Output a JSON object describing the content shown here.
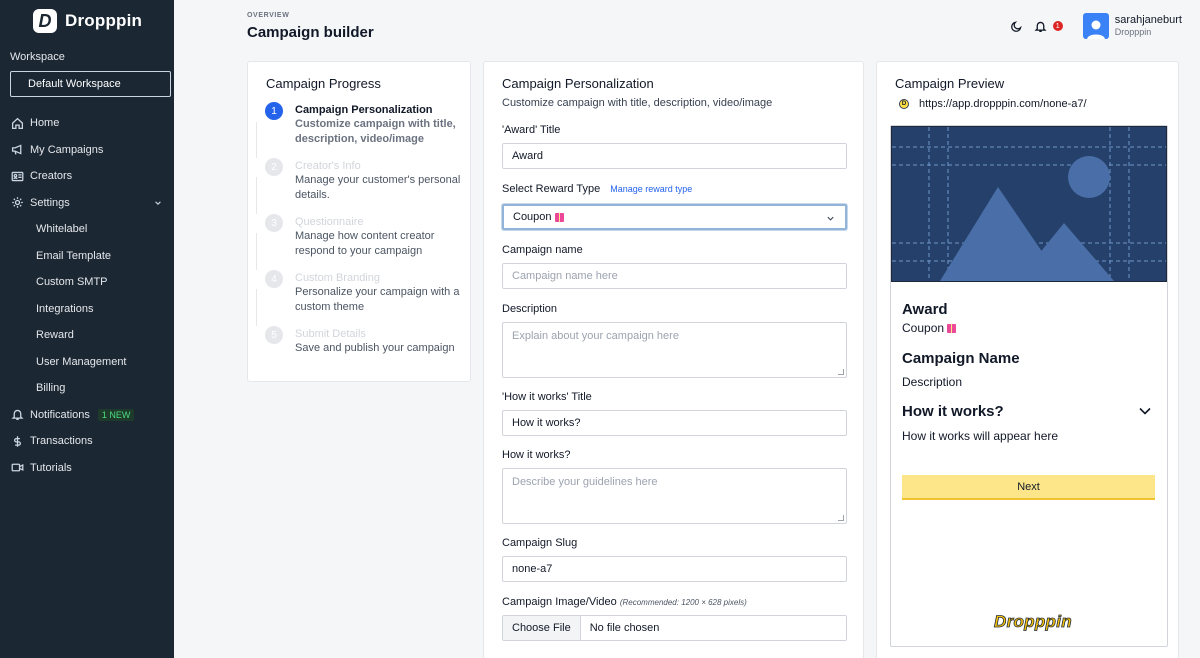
{
  "brand": {
    "logo_letter": "D",
    "name": "Dropppin"
  },
  "workspace": {
    "label": "Workspace",
    "current": "Default Workspace"
  },
  "nav": {
    "home": "Home",
    "my_campaigns": "My Campaigns",
    "creators": "Creators",
    "settings": "Settings",
    "whitelabel": "Whitelabel",
    "email_template": "Email Template",
    "custom_smtp": "Custom SMTP",
    "integrations": "Integrations",
    "reward": "Reward",
    "user_management": "User Management",
    "billing": "Billing",
    "notifications": "Notifications",
    "notifications_badge": "1 NEW",
    "transactions": "Transactions",
    "tutorials": "Tutorials"
  },
  "header": {
    "overline": "OVERVIEW",
    "title": "Campaign builder",
    "notification_count": "1",
    "user_name": "sarahjaneburt",
    "user_org": "Dropppin"
  },
  "progress": {
    "title": "Campaign Progress",
    "steps": [
      {
        "num": "1",
        "title": "Campaign Personalization",
        "desc": "Customize campaign with title, description, video/image"
      },
      {
        "num": "2",
        "title": "Creator's Info",
        "desc": "Manage your customer's personal details."
      },
      {
        "num": "3",
        "title": "Questionnaire",
        "desc": "Manage how content creator respond to your campaign"
      },
      {
        "num": "4",
        "title": "Custom Branding",
        "desc": "Personalize your campaign with a custom theme"
      },
      {
        "num": "5",
        "title": "Submit Details",
        "desc": "Save and publish your campaign"
      }
    ]
  },
  "form": {
    "title": "Campaign Personalization",
    "subtitle": "Customize campaign with title, description, video/image",
    "award_title_label": "'Award' Title",
    "award_title_value": "Award",
    "reward_type_label": "Select Reward Type",
    "manage_reward_link": "Manage reward type",
    "reward_type_value": "Coupon",
    "campaign_name_label": "Campaign name",
    "campaign_name_placeholder": "Campaign name here",
    "description_label": "Description",
    "description_placeholder": "Explain about your campaign here",
    "how_title_label": "'How it works' Title",
    "how_title_value": "How it works?",
    "how_label": "How it works?",
    "how_placeholder": "Describe your guidelines here",
    "slug_label": "Campaign Slug",
    "slug_value": "none-a7",
    "media_label": "Campaign Image/Video",
    "media_hint": "(Recommended: 1200 × 628 pixels)",
    "choose_file": "Choose File",
    "no_file": "No file chosen"
  },
  "preview": {
    "title": "Campaign Preview",
    "url": "https://app.dropppin.com/none-a7/",
    "award": "Award",
    "coupon": "Coupon",
    "campaign_name": "Campaign Name",
    "description": "Description",
    "how_title": "How it works?",
    "how_text": "How it works will appear here",
    "next_button": "Next",
    "logo_text": "Dropppin"
  },
  "colors": {
    "sidebar_bg": "#1b2733",
    "accent": "#2563eb",
    "next_button": "#fde68a",
    "preview_image_bg": "#24406b"
  }
}
